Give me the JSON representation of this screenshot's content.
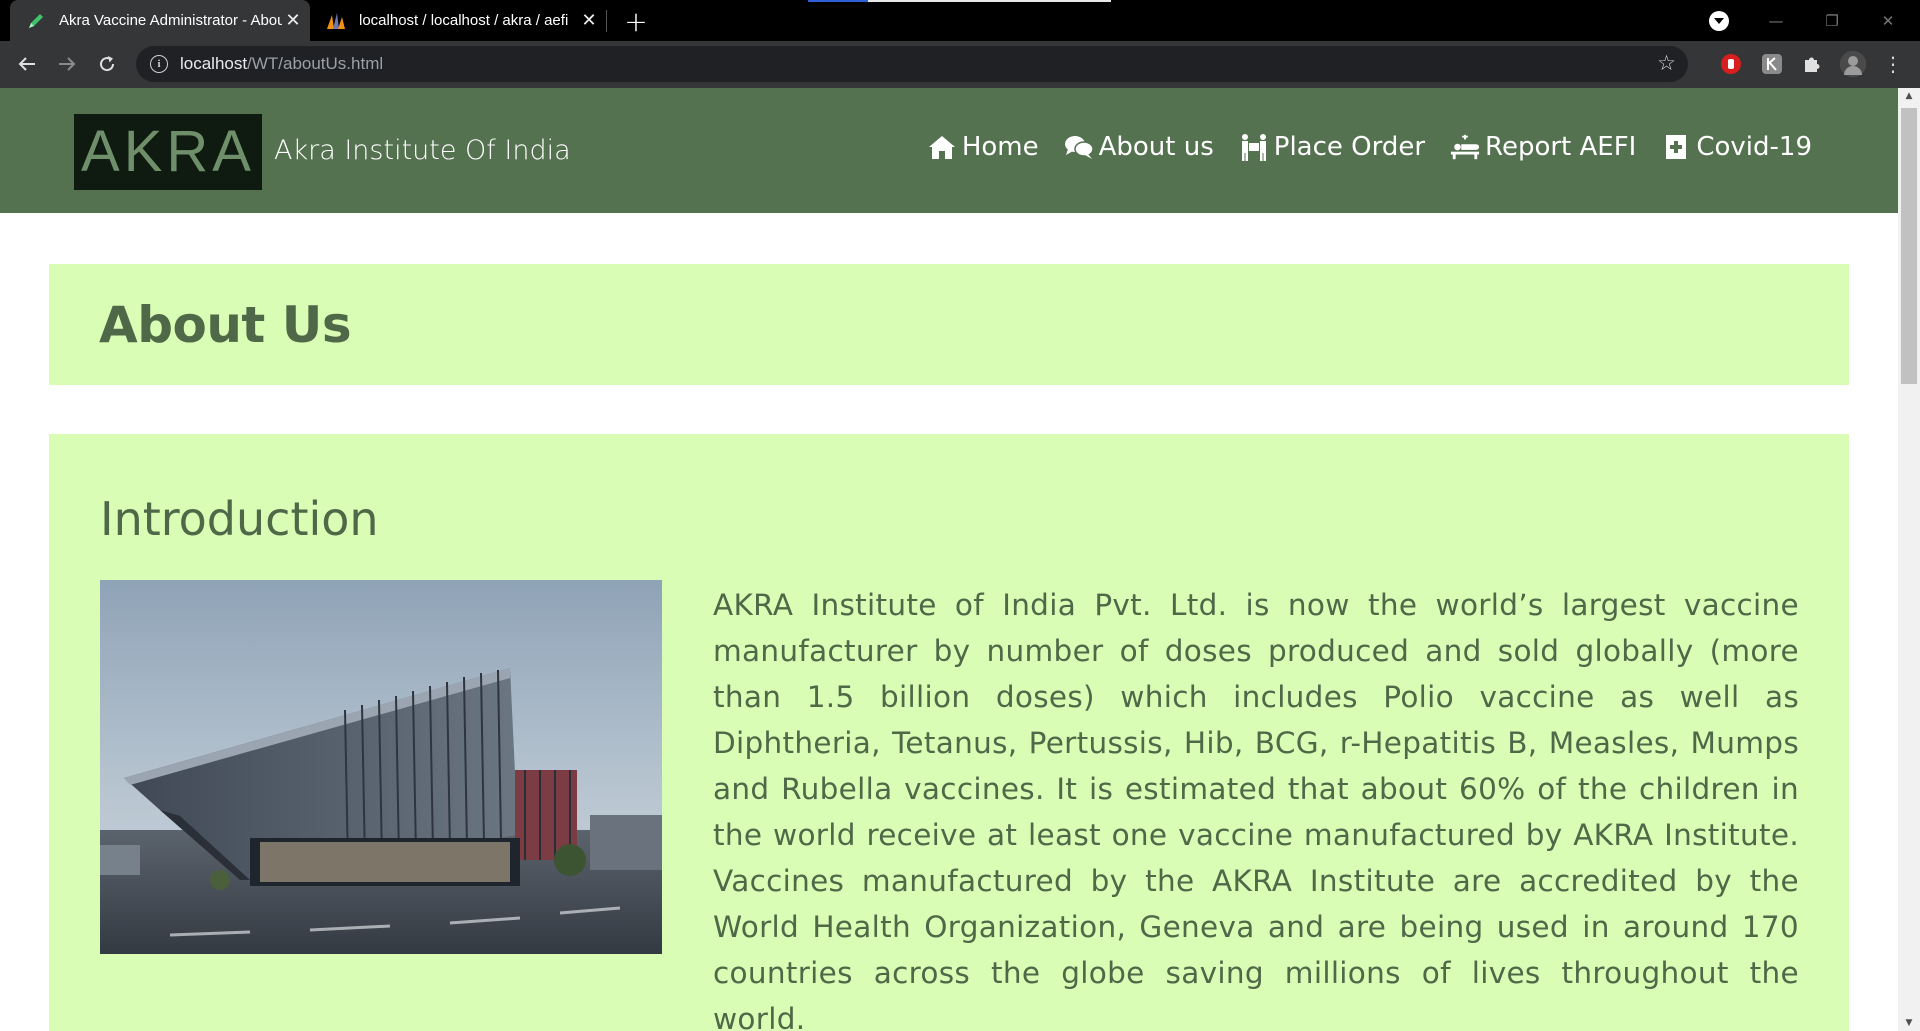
{
  "browser": {
    "tabs": [
      {
        "title": "Akra Vaccine Administrator - About Us",
        "active": true,
        "favicon": "pencil-icon"
      },
      {
        "title": "localhost / localhost / akra / aefi",
        "active": false,
        "favicon": "phpmyadmin-icon"
      }
    ],
    "new_tab_symbol": "+",
    "close_symbol": "✕",
    "url_host": "localhost",
    "url_path": "/WT/aboutUs.html",
    "window_controls": {
      "minimize": "—",
      "restore": "❐",
      "close": "✕"
    }
  },
  "site": {
    "logo_text": "AKRA",
    "brand_name": "Akra Institute Of India",
    "nav": [
      {
        "label": "Home",
        "icon": "home-icon"
      },
      {
        "label": "About us",
        "icon": "chat-bubbles-icon"
      },
      {
        "label": "Place Order",
        "icon": "people-carry-icon"
      },
      {
        "label": "Report AEFI",
        "icon": "procedures-icon"
      },
      {
        "label": "Covid-19",
        "icon": "medical-file-icon"
      }
    ]
  },
  "page": {
    "heading": "About Us",
    "intro": {
      "heading": "Introduction",
      "image_alt": "building-photo",
      "paragraph": "AKRA Institute of India Pvt. Ltd. is now the world’s largest vaccine manufacturer by number of doses produced and sold globally (more than 1.5 billion doses) which includes Polio vaccine as well as Diphtheria, Tetanus, Pertussis, Hib, BCG, r-Hepatitis B, Measles, Mumps and Rubella vaccines. It is estimated that about 60% of the children in the world receive at least one vaccine manufactured by AKRA Institute. Vaccines manufactured by the AKRA Institute are accredited by the World Health Organization, Geneva and are being used in around 170 countries across the globe saving millions of lives throughout the world."
    }
  },
  "colors": {
    "nav_bg": "#557250",
    "panel_bg": "#dafdb5",
    "heading_text": "#4e6848",
    "logo_bg": "#0f1a10"
  }
}
